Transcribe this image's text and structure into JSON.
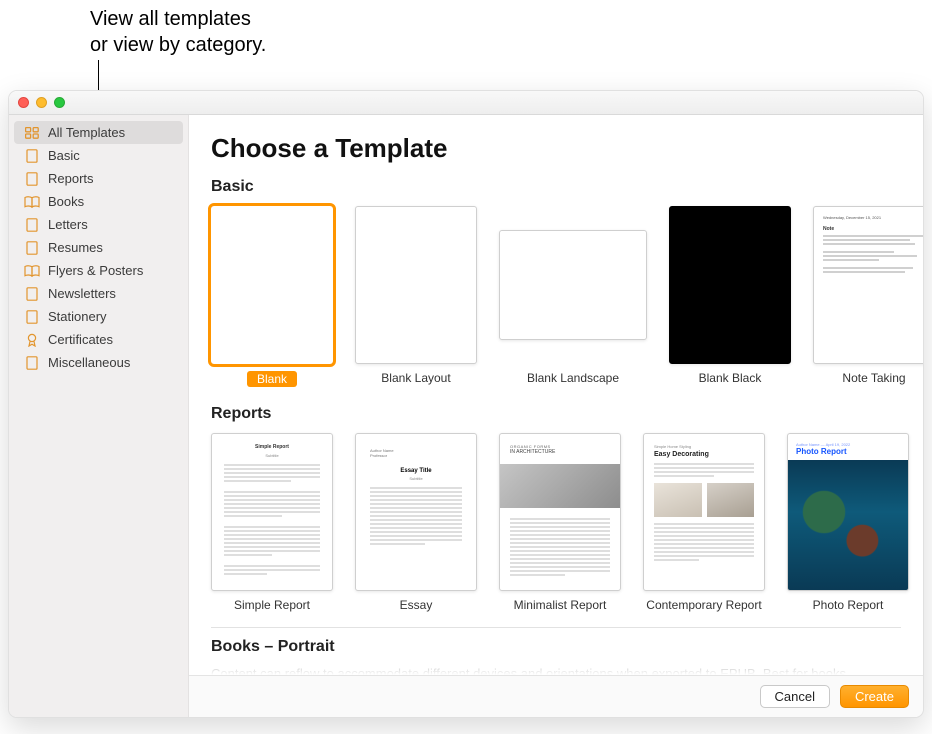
{
  "annotation": {
    "line1": "View all templates",
    "line2": "or view by category."
  },
  "sidebar": {
    "items": [
      {
        "label": "All Templates",
        "icon": "grid",
        "selected": true
      },
      {
        "label": "Basic",
        "icon": "doc"
      },
      {
        "label": "Reports",
        "icon": "doc"
      },
      {
        "label": "Books",
        "icon": "book"
      },
      {
        "label": "Letters",
        "icon": "doc"
      },
      {
        "label": "Resumes",
        "icon": "doc"
      },
      {
        "label": "Flyers & Posters",
        "icon": "book"
      },
      {
        "label": "Newsletters",
        "icon": "doc"
      },
      {
        "label": "Stationery",
        "icon": "doc"
      },
      {
        "label": "Certificates",
        "icon": "badge"
      },
      {
        "label": "Miscellaneous",
        "icon": "doc"
      }
    ]
  },
  "main": {
    "title": "Choose a Template",
    "sections": {
      "basic": {
        "title": "Basic",
        "items": [
          {
            "label": "Blank",
            "selected": true
          },
          {
            "label": "Blank Layout"
          },
          {
            "label": "Blank Landscape",
            "landscape": true
          },
          {
            "label": "Blank Black",
            "black": true
          },
          {
            "label": "Note Taking"
          }
        ]
      },
      "reports": {
        "title": "Reports",
        "items": [
          {
            "label": "Simple Report"
          },
          {
            "label": "Essay"
          },
          {
            "label": "Minimalist Report"
          },
          {
            "label": "Contemporary Report"
          },
          {
            "label": "Photo Report"
          }
        ]
      },
      "books": {
        "title": "Books – Portrait",
        "desc": "Content can reflow to accommodate different devices and orientations when exported to EPUB. Best for books"
      }
    }
  },
  "footer": {
    "cancel": "Cancel",
    "create": "Create"
  },
  "thumb_text": {
    "simple_report_title": "Simple Report",
    "simple_report_sub": "Subtitle",
    "essay_title": "Essay Title",
    "essay_sub": "Subtitle",
    "min_cat": "ORGANIC FORMS",
    "min_h": "IN ARCHITECTURE",
    "cont_cat": "Simple Home Styling",
    "cont_h": "Easy Decorating",
    "photo_cat": "Author Name — April 19, 2022",
    "photo_h": "Photo Report",
    "note_date": "Wednesday, December 15, 2021",
    "note_h": "Note"
  }
}
